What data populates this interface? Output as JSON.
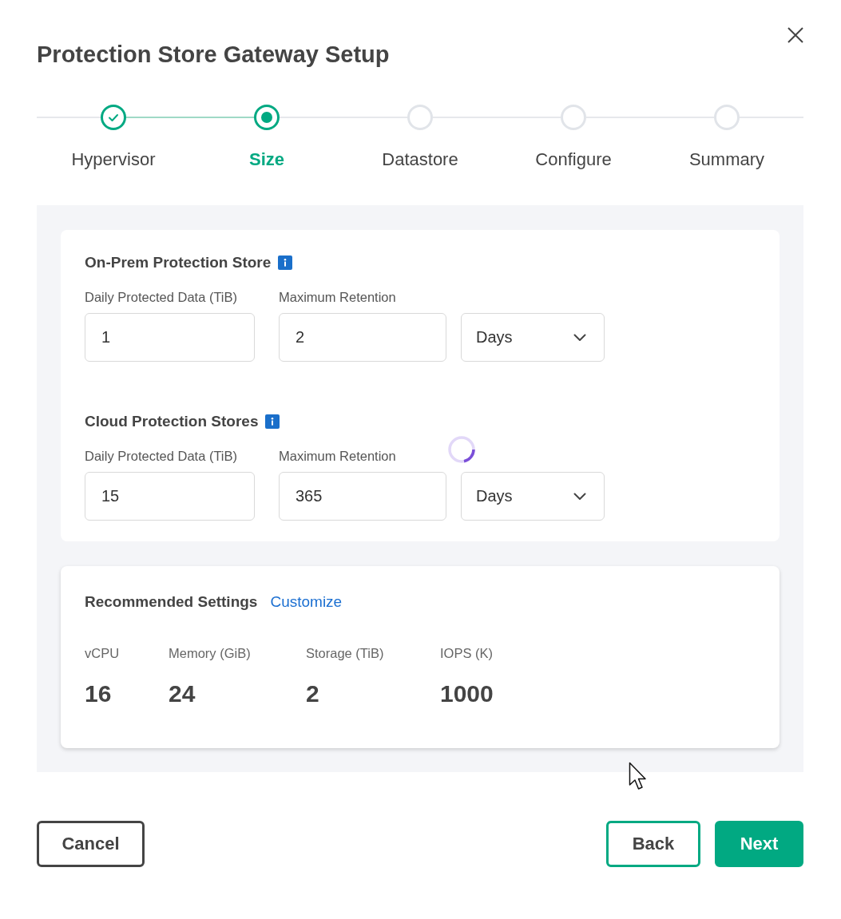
{
  "dialog": {
    "title": "Protection Store Gateway Setup"
  },
  "steps": [
    {
      "label": "Hypervisor",
      "completed": true,
      "selected": false
    },
    {
      "label": "Size",
      "completed": false,
      "selected": true
    },
    {
      "label": "Datastore",
      "completed": false,
      "selected": false
    },
    {
      "label": "Configure",
      "completed": false,
      "selected": false
    },
    {
      "label": "Summary",
      "completed": false,
      "selected": false
    }
  ],
  "sections": [
    {
      "heading": "On-Prem Protection Store",
      "fields": [
        {
          "label": "Daily Protected Data (TiB)",
          "value": "1"
        },
        {
          "label": "Maximum Retention",
          "value": "2"
        }
      ],
      "unit": {
        "value": "Days"
      }
    },
    {
      "heading": "Cloud Protection Stores",
      "loading": true,
      "fields": [
        {
          "label": "Daily Protected Data (TiB)",
          "value": "15"
        },
        {
          "label": "Maximum Retention",
          "value": "365"
        }
      ],
      "unit": {
        "value": "Days"
      }
    }
  ],
  "recommended": {
    "heading": "Recommended Settings",
    "link": "Customize",
    "metrics": [
      {
        "label": "vCPU",
        "value": "16"
      },
      {
        "label": "Memory (GiB)",
        "value": "24"
      },
      {
        "label": "Storage (TiB)",
        "value": "2"
      },
      {
        "label": "IOPS (K)",
        "value": "1000"
      }
    ]
  },
  "buttons": [
    {
      "label": "Cancel",
      "kind": "secondary"
    },
    {
      "label": "Back",
      "kind": "outline"
    },
    {
      "label": "Next",
      "kind": "primary"
    }
  ]
}
